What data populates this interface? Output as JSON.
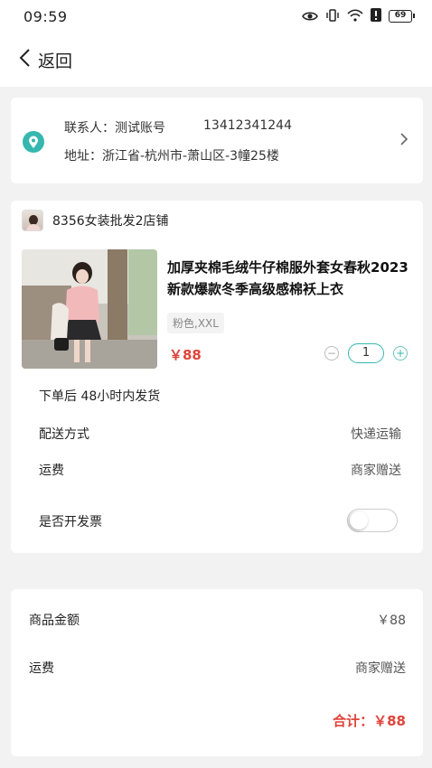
{
  "status_bar": {
    "time": "09:59",
    "battery": "69"
  },
  "nav": {
    "back_label": "返回"
  },
  "address": {
    "contact_label": "联系人：",
    "contact_name": "测试账号",
    "phone": "13412341244",
    "address_label": "地址：",
    "address_text": "浙江省-杭州市-萧山区-3幢25楼"
  },
  "order": {
    "store_name": "8356女装批发2店铺",
    "product_title": "加厚夹棉毛绒牛仔棉服外套女春秋2023新款爆款冬季高级感棉袄上衣",
    "spec": "粉色,XXL",
    "price": "￥88",
    "quantity": "1",
    "qty_minus": "−",
    "qty_plus": "+",
    "ship_note": "下单后 48小时内发货",
    "delivery_label": "配送方式",
    "delivery_value": "快递运输",
    "freight_label": "运费",
    "freight_value": "商家赠送",
    "invoice_label": "是否开发票",
    "invoice_on": false
  },
  "summary": {
    "goods_label": "商品金额",
    "goods_value": "￥88",
    "freight_label": "运费",
    "freight_value": "商家赠送",
    "total": "合计：￥88"
  },
  "colors": {
    "accent": "#36b7b0",
    "price": "#e0443a"
  }
}
